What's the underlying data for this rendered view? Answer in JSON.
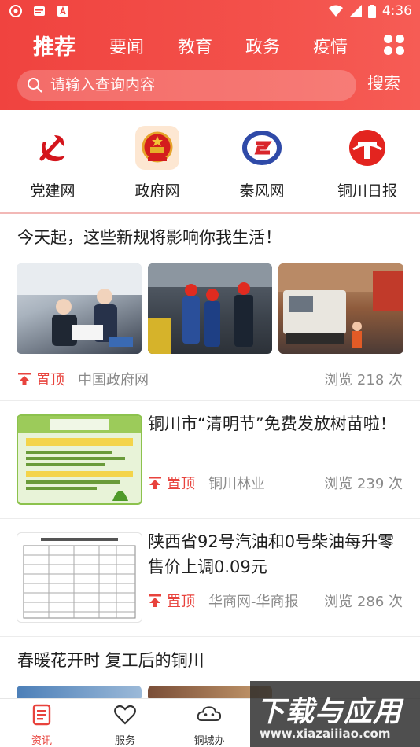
{
  "status_bar": {
    "time": "4:36"
  },
  "header": {
    "tabs": [
      {
        "label": "推荐",
        "active": true
      },
      {
        "label": "要闻",
        "active": false
      },
      {
        "label": "教育",
        "active": false
      },
      {
        "label": "政务",
        "active": false
      },
      {
        "label": "疫情",
        "active": false
      }
    ],
    "search_placeholder": "请输入查询内容",
    "search_button": "搜索"
  },
  "portals": [
    {
      "label": "党建网",
      "icon": "party-emblem-icon"
    },
    {
      "label": "政府网",
      "icon": "national-emblem-icon"
    },
    {
      "label": "秦风网",
      "icon": "qinfeng-logo-icon"
    },
    {
      "label": "铜川日报",
      "icon": "tongchuan-daily-logo-icon"
    }
  ],
  "feed": [
    {
      "title": "今天起，这些新规将影响你我生活！",
      "pin_label": "置顶",
      "source": "中国政府网",
      "views": "浏览 218 次"
    },
    {
      "title": "铜川市“清明节”免费发放树苗啦！",
      "pin_label": "置顶",
      "source": "铜川林业",
      "views": "浏览 239 次"
    },
    {
      "title": "陕西省92号汽油和0号柴油每升零售价上调0.09元",
      "pin_label": "置顶",
      "source": "华商网-华商报",
      "views": "浏览 286 次"
    },
    {
      "title": "春暖花开时 复工后的铜川"
    }
  ],
  "bottom_nav": [
    {
      "label": "资讯",
      "active": true,
      "icon": "news-icon"
    },
    {
      "label": "服务",
      "active": false,
      "icon": "heart-icon"
    },
    {
      "label": "铜城办",
      "active": false,
      "icon": "cloud-icon"
    }
  ],
  "watermark": {
    "main": "下载与应用",
    "sub": "www.xiazaiiiao.com"
  },
  "colors": {
    "brand_red": "#f0433f",
    "pin_red": "#e8433d",
    "muted": "#8a8a8a"
  }
}
